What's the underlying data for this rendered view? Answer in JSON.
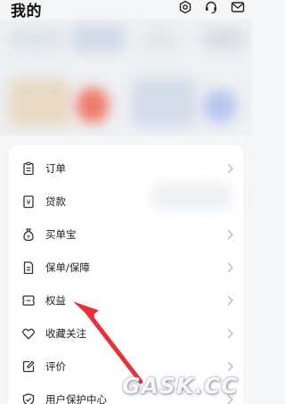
{
  "header": {
    "title": "我的",
    "icons": [
      "settings-icon",
      "customer-service-icon",
      "mail-icon"
    ]
  },
  "menu": [
    {
      "label": "订单",
      "icon": "clipboard-icon"
    },
    {
      "label": "贷款",
      "icon": "yen-document-icon"
    },
    {
      "label": "买单宝",
      "icon": "money-bag-icon"
    },
    {
      "label": "保单/保障",
      "icon": "document-icon"
    },
    {
      "label": "权益",
      "icon": "ticket-icon"
    },
    {
      "label": "收藏关注",
      "icon": "heart-icon"
    },
    {
      "label": "评价",
      "icon": "edit-icon"
    },
    {
      "label": "用户保护中心",
      "icon": "shield-icon"
    }
  ],
  "annotation": {
    "color": "#e8323a",
    "target": "权益"
  },
  "watermark": "GASK.CC",
  "colors": {
    "background": "#f5f6f8",
    "card": "#ffffff",
    "text": "#222222",
    "chevron": "#b8bcc4"
  }
}
